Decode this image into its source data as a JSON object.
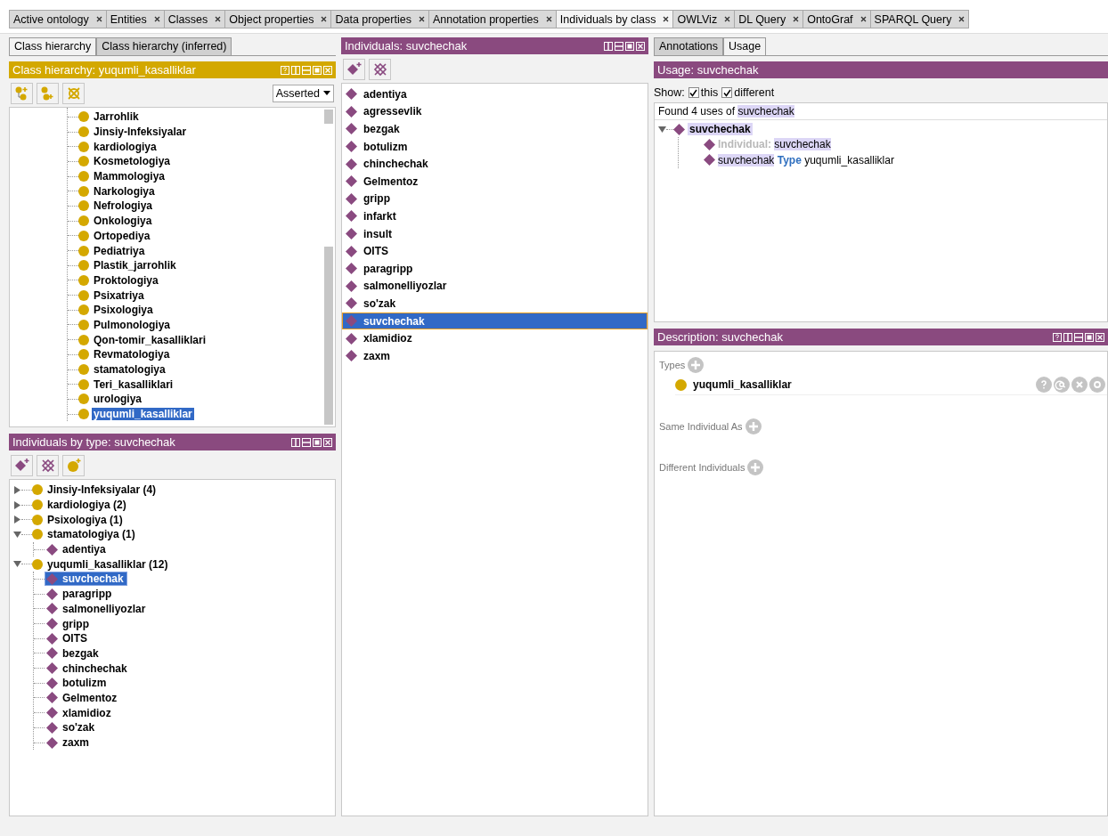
{
  "tabs": [
    {
      "label": "Active ontology",
      "selected": false
    },
    {
      "label": "Entities",
      "selected": false
    },
    {
      "label": "Classes",
      "selected": false
    },
    {
      "label": "Object properties",
      "selected": false
    },
    {
      "label": "Data properties",
      "selected": false
    },
    {
      "label": "Annotation properties",
      "selected": false
    },
    {
      "label": "Individuals by class",
      "selected": true
    },
    {
      "label": "OWLViz",
      "selected": false
    },
    {
      "label": "DL Query",
      "selected": false
    },
    {
      "label": "OntoGraf",
      "selected": false
    },
    {
      "label": "SPARQL Query",
      "selected": false
    }
  ],
  "left_tabs": [
    {
      "label": "Class hierarchy",
      "selected": true
    },
    {
      "label": "Class hierarchy (inferred)",
      "selected": false
    }
  ],
  "class_hierarchy": {
    "title": "Class hierarchy: yuqumli_kasalliklar",
    "mode": "Asserted",
    "items": [
      {
        "label": "Jarrohlik",
        "selected": false
      },
      {
        "label": "Jinsiy-Infeksiyalar",
        "selected": false
      },
      {
        "label": "kardiologiya",
        "selected": false
      },
      {
        "label": "Kosmetologiya",
        "selected": false
      },
      {
        "label": "Mammologiya",
        "selected": false
      },
      {
        "label": "Narkologiya",
        "selected": false
      },
      {
        "label": "Nefrologiya",
        "selected": false
      },
      {
        "label": "Onkologiya",
        "selected": false
      },
      {
        "label": "Ortopediya",
        "selected": false
      },
      {
        "label": "Pediatriya",
        "selected": false
      },
      {
        "label": "Plastik_jarrohlik",
        "selected": false
      },
      {
        "label": "Proktologiya",
        "selected": false
      },
      {
        "label": "Psixatriya",
        "selected": false
      },
      {
        "label": "Psixologiya",
        "selected": false
      },
      {
        "label": "Pulmonologiya",
        "selected": false
      },
      {
        "label": "Qon-tomir_kasalliklari",
        "selected": false
      },
      {
        "label": "Revmatologiya",
        "selected": false
      },
      {
        "label": "stamatologiya",
        "selected": false
      },
      {
        "label": "Teri_kasalliklari",
        "selected": false
      },
      {
        "label": "urologiya",
        "selected": false
      },
      {
        "label": "yuqumli_kasalliklar",
        "selected": true
      }
    ]
  },
  "individuals_by_type": {
    "title": "Individuals by type: suvchechak",
    "classes": [
      {
        "label": "Jinsiy-Infeksiyalar (4)",
        "expanded": false
      },
      {
        "label": "kardiologiya (2)",
        "expanded": false
      },
      {
        "label": "Psixologiya (1)",
        "expanded": false
      },
      {
        "label": "stamatologiya (1)",
        "expanded": true,
        "children": [
          {
            "label": "adentiya",
            "selected": false
          }
        ]
      },
      {
        "label": "yuqumli_kasalliklar (12)",
        "expanded": true,
        "children": [
          {
            "label": "suvchechak",
            "selected": true
          },
          {
            "label": "paragripp",
            "selected": false
          },
          {
            "label": "salmonelliyozlar",
            "selected": false
          },
          {
            "label": "gripp",
            "selected": false
          },
          {
            "label": "OITS",
            "selected": false
          },
          {
            "label": "bezgak",
            "selected": false
          },
          {
            "label": "chinchechak",
            "selected": false
          },
          {
            "label": "botulizm",
            "selected": false
          },
          {
            "label": "Gelmentoz",
            "selected": false
          },
          {
            "label": "xlamidioz",
            "selected": false
          },
          {
            "label": "so'zak",
            "selected": false
          },
          {
            "label": "zaxm",
            "selected": false
          }
        ]
      }
    ]
  },
  "individuals": {
    "title": "Individuals: suvchechak",
    "items": [
      {
        "label": "adentiya",
        "selected": false
      },
      {
        "label": "agressevlik",
        "selected": false
      },
      {
        "label": "bezgak",
        "selected": false
      },
      {
        "label": "botulizm",
        "selected": false
      },
      {
        "label": "chinchechak",
        "selected": false
      },
      {
        "label": "Gelmentoz",
        "selected": false
      },
      {
        "label": "gripp",
        "selected": false
      },
      {
        "label": "infarkt",
        "selected": false
      },
      {
        "label": "insult",
        "selected": false
      },
      {
        "label": "OITS",
        "selected": false
      },
      {
        "label": "paragripp",
        "selected": false
      },
      {
        "label": "salmonelliyozlar",
        "selected": false
      },
      {
        "label": "so'zak",
        "selected": false
      },
      {
        "label": "suvchechak",
        "selected": true
      },
      {
        "label": "xlamidioz",
        "selected": false
      },
      {
        "label": "zaxm",
        "selected": false
      }
    ]
  },
  "right_tabs": [
    {
      "label": "Annotations",
      "selected": false
    },
    {
      "label": "Usage",
      "selected": true
    }
  ],
  "usage": {
    "title": "Usage: suvchechak",
    "show_label": "Show:",
    "filters": [
      {
        "label": "this",
        "checked": true
      },
      {
        "label": "different",
        "checked": true
      }
    ],
    "summary": "Found 4 uses of",
    "summary_entity": "suvchechak",
    "root": {
      "label": "suvchechak",
      "expanded": true
    },
    "uses": [
      {
        "kind": "declaration",
        "prefix": "Individual:",
        "entity": "suvchechak"
      },
      {
        "kind": "axiom",
        "entity": "suvchechak",
        "keyword": "Type",
        "object": "yuqumli_kasalliklar"
      }
    ]
  },
  "description": {
    "title": "Description: suvchechak",
    "sections": [
      {
        "label": "Types",
        "items": [
          "yuqumli_kasalliklar"
        ]
      },
      {
        "label": "Same Individual As"
      },
      {
        "label": "Different Individuals"
      }
    ]
  }
}
